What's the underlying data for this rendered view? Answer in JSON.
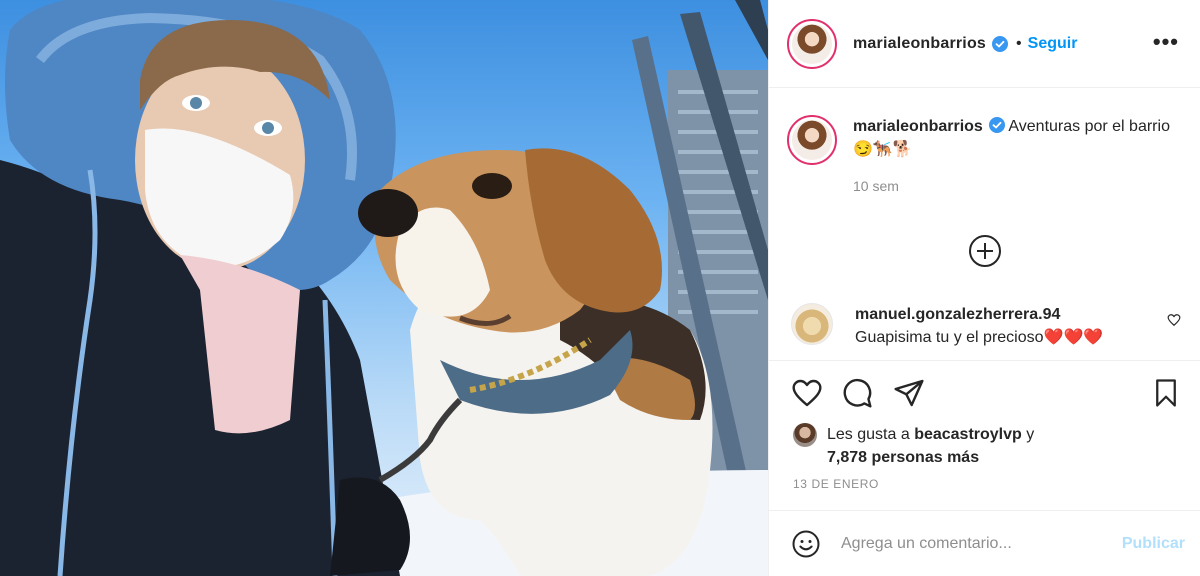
{
  "post": {
    "username": "marialeonbarrios",
    "follow_label": "Seguir",
    "dot": "•",
    "more_label": "•••"
  },
  "caption": {
    "username": "marialeonbarrios",
    "text": "Aventuras por el barrio 😏🐕‍🦺🐕",
    "time": "10 sem"
  },
  "comments": [
    {
      "username": "manuel.gonzalezherrera.94",
      "text": "Guapisima tu y el precioso❤️❤️❤️"
    }
  ],
  "likes": {
    "prefix": "Les gusta a",
    "user": "beacastroylvp",
    "connector": "y",
    "count_text": "7,878 personas más"
  },
  "date": "13 DE ENERO",
  "comment_box": {
    "placeholder": "Agrega un comentario...",
    "publish_label": "Publicar"
  },
  "icons": {
    "like": "heart-icon",
    "comment": "comment-icon",
    "share": "paper-plane-icon",
    "save": "bookmark-icon",
    "emoji": "emoji-icon",
    "verified": "verified-badge-icon"
  },
  "colors": {
    "accent": "#0095f6",
    "publish_disabled": "#b2dffc",
    "muted": "#8e8e8e",
    "text": "#262626",
    "story_ring": "#e1306c"
  }
}
